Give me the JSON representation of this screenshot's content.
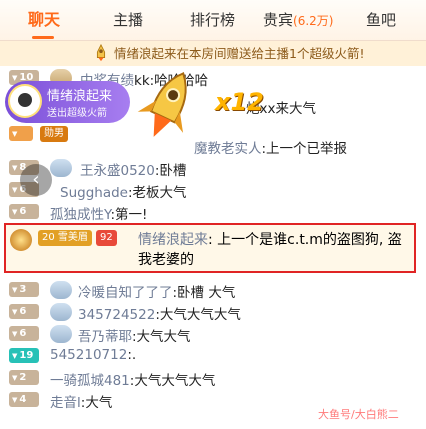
{
  "tabs": [
    {
      "label": "聊天",
      "active": true
    },
    {
      "label": "主播",
      "active": false
    },
    {
      "label": "排行榜",
      "active": false
    },
    {
      "label": "贵宾",
      "count": "(6.2万)",
      "active": false
    },
    {
      "label": "鱼吧",
      "active": false
    }
  ],
  "gift_banner": {
    "text": "情绪浪起来在本房间赠送给主播1个超级火箭!"
  },
  "gift_popup": {
    "sender": "情绪浪起来",
    "subtitle": "送出超级火箭",
    "multiplier": "x12"
  },
  "messages": [
    {
      "level": "10",
      "medal": "",
      "name": "中奖有绩",
      "text": "kk:哈哈哈哈"
    },
    {
      "level": "",
      "medal": "",
      "name": "",
      "text": "炮xx来大气"
    },
    {
      "level": "",
      "medal": "勋男",
      "name": "",
      "text": ""
    },
    {
      "level": "",
      "medal": "",
      "name": "魔教老实人",
      "text": ":上一个已举报"
    },
    {
      "level": "8",
      "medal": "",
      "name": "王永盛0520",
      "text": ":卧槽"
    },
    {
      "level": "6",
      "medal": "",
      "name": "Sugghade",
      "text": ":老板大气"
    },
    {
      "level": "6",
      "medal": "",
      "name": "孤独成性Y",
      "text": ":第一!"
    },
    {
      "level": "20",
      "medal": "20 雪美眉",
      "badge": "92",
      "name": "情绪浪起来",
      "text": ": 上一个是谁c.t.m的盗图狗, 盗我老婆的",
      "highlighted": true
    },
    {
      "level": "3",
      "medal": "",
      "name": "冷暖自知了了了",
      "text": ":卧槽 大气"
    },
    {
      "level": "6",
      "medal": "",
      "name": "345724522",
      "text": ":大气大气大气"
    },
    {
      "level": "6",
      "medal": "",
      "name": "吾乃蒂耶",
      "text": ":大气大气"
    },
    {
      "level": "19",
      "medal": "",
      "name": "545210712",
      "text": ":."
    },
    {
      "level": "2",
      "medal": "",
      "name": "一骑孤城481",
      "text": ":大气大气大气"
    },
    {
      "level": "4",
      "medal": "",
      "name": "走音l",
      "text": ":大气"
    }
  ],
  "watermark": "大鱼号/大白熊二",
  "colors": {
    "accent": "#ff6a1a",
    "name": "#6f7c96",
    "highlight_border": "#e02424"
  },
  "icons": {
    "prev": "chevron-left-icon",
    "rocket": "rocket-icon"
  }
}
